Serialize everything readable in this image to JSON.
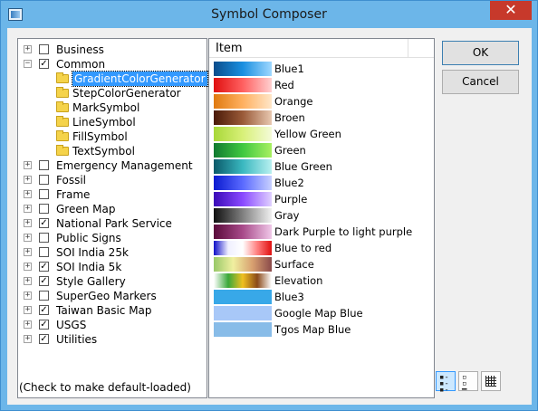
{
  "window": {
    "title": "Symbol Composer",
    "close_label": "✕"
  },
  "tree": [
    {
      "label": "Business",
      "checked": false,
      "expander": "+",
      "level": 0
    },
    {
      "label": "Common",
      "checked": true,
      "expander": "−",
      "level": 0
    },
    {
      "label": "GradientColorGenerator",
      "level": 1,
      "selected": true
    },
    {
      "label": "StepColorGenerator",
      "level": 1
    },
    {
      "label": "MarkSymbol",
      "level": 1
    },
    {
      "label": "LineSymbol",
      "level": 1
    },
    {
      "label": "FillSymbol",
      "level": 1
    },
    {
      "label": "TextSymbol",
      "level": 1
    },
    {
      "label": "Emergency Management",
      "checked": false,
      "expander": "+",
      "level": 0
    },
    {
      "label": "Fossil",
      "checked": false,
      "expander": "+",
      "level": 0
    },
    {
      "label": "Frame",
      "checked": false,
      "expander": "+",
      "level": 0
    },
    {
      "label": "Green Map",
      "checked": false,
      "expander": "+",
      "level": 0
    },
    {
      "label": "National Park Service",
      "checked": true,
      "expander": "+",
      "level": 0
    },
    {
      "label": "Public Signs",
      "checked": false,
      "expander": "+",
      "level": 0
    },
    {
      "label": "SOI India 25k",
      "checked": false,
      "expander": "+",
      "level": 0
    },
    {
      "label": "SOI India 5k",
      "checked": true,
      "expander": "+",
      "level": 0
    },
    {
      "label": "Style Gallery",
      "checked": true,
      "expander": "+",
      "level": 0
    },
    {
      "label": "SuperGeo Markers",
      "checked": false,
      "expander": "+",
      "level": 0
    },
    {
      "label": "Taiwan Basic Map",
      "checked": true,
      "expander": "+",
      "level": 0
    },
    {
      "label": "USGS",
      "checked": true,
      "expander": "+",
      "level": 0
    },
    {
      "label": "Utilities",
      "checked": true,
      "expander": "+",
      "level": 0
    }
  ],
  "item_list": {
    "header": "Item",
    "items": [
      {
        "label": "Blue1",
        "colors": [
          "#0a4d8c",
          "#1a8fe0",
          "#9fd8ff"
        ]
      },
      {
        "label": "Red",
        "colors": [
          "#e01010",
          "#ff6060",
          "#ffd0d0"
        ]
      },
      {
        "label": "Orange",
        "colors": [
          "#e07a10",
          "#ffb060",
          "#ffe6c8"
        ]
      },
      {
        "label": "Broen",
        "colors": [
          "#4a1a08",
          "#9a5a38",
          "#e8c8b0"
        ]
      },
      {
        "label": "Yellow Green",
        "colors": [
          "#a8d838",
          "#d8f078",
          "#f4fbd8"
        ]
      },
      {
        "label": "Green",
        "colors": [
          "#107a30",
          "#40c840",
          "#a8f060"
        ]
      },
      {
        "label": "Blue Green",
        "colors": [
          "#0a5a6a",
          "#3ab8c0",
          "#b8f0f0"
        ]
      },
      {
        "label": "Blue2",
        "colors": [
          "#0a1ad0",
          "#5a6aff",
          "#c8d0ff"
        ]
      },
      {
        "label": "Purple",
        "colors": [
          "#3a0ab8",
          "#8a4aff",
          "#e0d0ff"
        ]
      },
      {
        "label": "Gray",
        "colors": [
          "#101010",
          "#808080",
          "#f0f0f0"
        ]
      },
      {
        "label": "Dark Purple to light purple",
        "colors": [
          "#5a0a3a",
          "#a84a8a",
          "#f0c8e8"
        ]
      },
      {
        "label": "Blue to red",
        "colors": [
          "#1010c8",
          "#f0f0ff",
          "#ffffff",
          "#ff8080",
          "#e01010"
        ]
      },
      {
        "label": "Surface",
        "colors": [
          "#98c868",
          "#f0f0a0",
          "#d8a070",
          "#8a4a4a"
        ]
      },
      {
        "label": "Elevation",
        "colors": [
          "#ffffff",
          "#3aa83a",
          "#f0c020",
          "#8a4a1a",
          "#ffffff"
        ]
      },
      {
        "label": "Blue3",
        "colors": [
          "#38a8e8",
          "#38a8e8"
        ]
      },
      {
        "label": "Google Map Blue",
        "colors": [
          "#a8c8f8",
          "#a8c8f8"
        ]
      },
      {
        "label": "Tgos Map Blue",
        "colors": [
          "#88bce8",
          "#88bce8"
        ]
      }
    ]
  },
  "buttons": {
    "ok": "OK",
    "cancel": "Cancel"
  },
  "footer_note": "(Check to make default-loaded)"
}
